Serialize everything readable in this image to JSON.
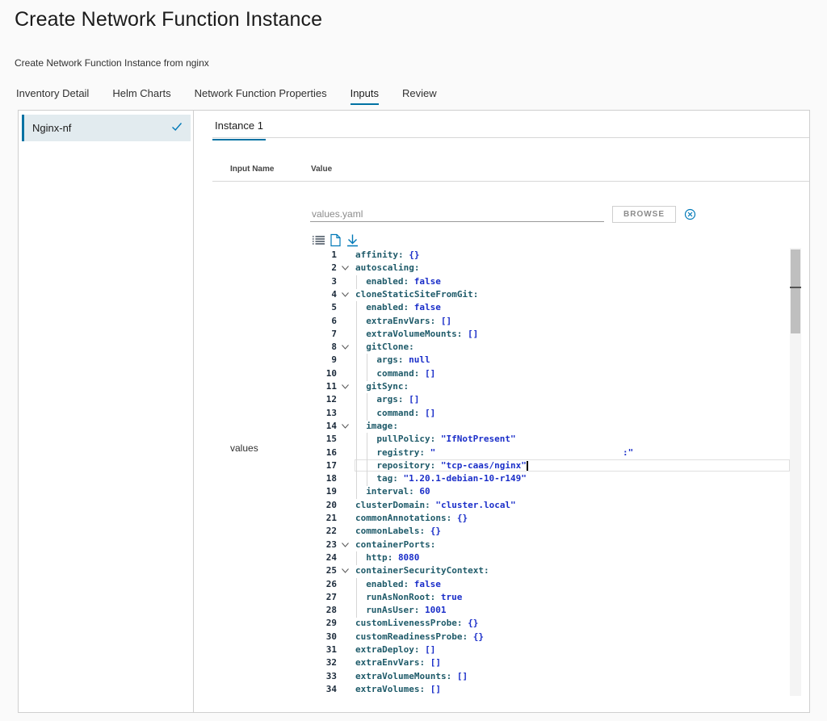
{
  "page": {
    "title": "Create Network Function Instance",
    "subtitle": "Create Network Function Instance from nginx"
  },
  "tabs": [
    {
      "label": "Inventory Detail",
      "active": false
    },
    {
      "label": "Helm Charts",
      "active": false
    },
    {
      "label": "Network Function Properties",
      "active": false
    },
    {
      "label": "Inputs",
      "active": true
    },
    {
      "label": "Review",
      "active": false
    }
  ],
  "sidebar": {
    "item_label": "Nginx-nf",
    "item_icon": "check-icon"
  },
  "instance_tab": "Instance 1",
  "table": {
    "col_input_name": "Input Name",
    "col_value": "Value",
    "row_label": "values"
  },
  "file_input": {
    "placeholder": "values.yaml",
    "value": ""
  },
  "browse_label": "BROWSE",
  "editor": {
    "toolbar_icons": [
      "list-icon",
      "file-icon",
      "download-icon"
    ],
    "active_line": 17,
    "lines": [
      {
        "n": "1",
        "indent": 0,
        "key": "affinity",
        "val": "{}",
        "fold": false
      },
      {
        "n": "2",
        "indent": 0,
        "key": "autoscaling",
        "val": "",
        "fold": true
      },
      {
        "n": "3",
        "indent": 1,
        "key": "enabled",
        "val": "false",
        "fold": false
      },
      {
        "n": "4",
        "indent": 0,
        "key": "cloneStaticSiteFromGit",
        "val": "",
        "fold": true
      },
      {
        "n": "5",
        "indent": 1,
        "key": "enabled",
        "val": "false",
        "fold": false
      },
      {
        "n": "6",
        "indent": 1,
        "key": "extraEnvVars",
        "val": "[]",
        "fold": false
      },
      {
        "n": "7",
        "indent": 1,
        "key": "extraVolumeMounts",
        "val": "[]",
        "fold": false
      },
      {
        "n": "8",
        "indent": 1,
        "key": "gitClone",
        "val": "",
        "fold": true
      },
      {
        "n": "9",
        "indent": 2,
        "key": "args",
        "val": "null",
        "fold": false
      },
      {
        "n": "10",
        "indent": 2,
        "key": "command",
        "val": "[]",
        "fold": false
      },
      {
        "n": "11",
        "indent": 1,
        "key": "gitSync",
        "val": "",
        "fold": true
      },
      {
        "n": "12",
        "indent": 2,
        "key": "args",
        "val": "[]",
        "fold": false
      },
      {
        "n": "13",
        "indent": 2,
        "key": "command",
        "val": "[]",
        "fold": false
      },
      {
        "n": "14",
        "indent": 1,
        "key": "image",
        "val": "",
        "fold": true
      },
      {
        "n": "15",
        "indent": 2,
        "key": "pullPolicy",
        "val": "\"IfNotPresent\"",
        "fold": false
      },
      {
        "n": "16",
        "indent": 2,
        "key": "registry",
        "val": "\"                                   :\"",
        "fold": false
      },
      {
        "n": "17",
        "indent": 2,
        "key": "repository",
        "val": "\"tcp-caas/nginx\"",
        "fold": false
      },
      {
        "n": "18",
        "indent": 2,
        "key": "tag",
        "val": "\"1.20.1-debian-10-r149\"",
        "fold": false
      },
      {
        "n": "19",
        "indent": 1,
        "key": "interval",
        "val": "60",
        "fold": false
      },
      {
        "n": "20",
        "indent": 0,
        "key": "clusterDomain",
        "val": "\"cluster.local\"",
        "fold": false
      },
      {
        "n": "21",
        "indent": 0,
        "key": "commonAnnotations",
        "val": "{}",
        "fold": false
      },
      {
        "n": "22",
        "indent": 0,
        "key": "commonLabels",
        "val": "{}",
        "fold": false
      },
      {
        "n": "23",
        "indent": 0,
        "key": "containerPorts",
        "val": "",
        "fold": true
      },
      {
        "n": "24",
        "indent": 1,
        "key": "http",
        "val": "8080",
        "fold": false
      },
      {
        "n": "25",
        "indent": 0,
        "key": "containerSecurityContext",
        "val": "",
        "fold": true
      },
      {
        "n": "26",
        "indent": 1,
        "key": "enabled",
        "val": "false",
        "fold": false
      },
      {
        "n": "27",
        "indent": 1,
        "key": "runAsNonRoot",
        "val": "true",
        "fold": false
      },
      {
        "n": "28",
        "indent": 1,
        "key": "runAsUser",
        "val": "1001",
        "fold": false
      },
      {
        "n": "29",
        "indent": 0,
        "key": "customLivenessProbe",
        "val": "{}",
        "fold": false
      },
      {
        "n": "30",
        "indent": 0,
        "key": "customReadinessProbe",
        "val": "{}",
        "fold": false
      },
      {
        "n": "31",
        "indent": 0,
        "key": "extraDeploy",
        "val": "[]",
        "fold": false
      },
      {
        "n": "32",
        "indent": 0,
        "key": "extraEnvVars",
        "val": "[]",
        "fold": false
      },
      {
        "n": "33",
        "indent": 0,
        "key": "extraVolumeMounts",
        "val": "[]",
        "fold": false
      },
      {
        "n": "34",
        "indent": 0,
        "key": "extraVolumes",
        "val": "[]",
        "fold": false
      }
    ]
  },
  "colors": {
    "accent": "#0072a3",
    "selected_bg": "#e2ebef",
    "check": "#0079b8",
    "yaml_key": "#1e5a69",
    "yaml_value": "#1a2ec9"
  }
}
